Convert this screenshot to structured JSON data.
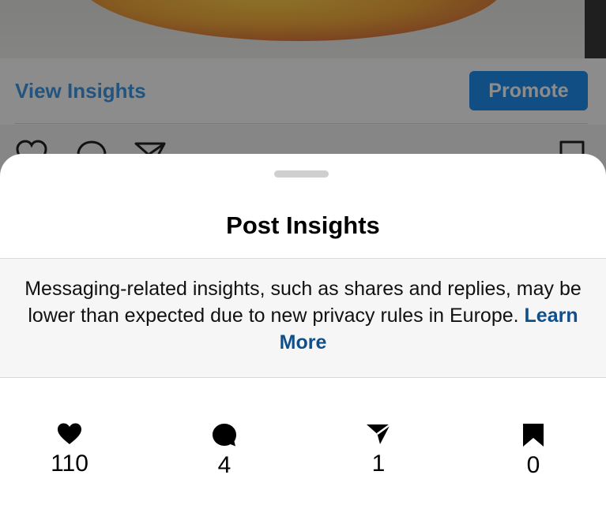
{
  "background_post": {
    "view_insights_label": "View Insights",
    "promote_label": "Promote",
    "colors": {
      "link": "#3f9ae8",
      "promote_bg": "#1f8ef1"
    },
    "icons": [
      "heart-outline-icon",
      "comment-outline-icon",
      "share-outline-icon",
      "bookmark-outline-icon"
    ]
  },
  "sheet": {
    "title": "Post Insights",
    "notice": {
      "text": "Messaging-related insights, such as shares and replies, may be lower than expected due to new privacy rules in Europe.",
      "link_label": "Learn More",
      "link_color": "#0f4f8c"
    },
    "stats": [
      {
        "icon": "heart-icon",
        "value": "110"
      },
      {
        "icon": "comment-icon",
        "value": "4"
      },
      {
        "icon": "share-icon",
        "value": "1"
      },
      {
        "icon": "bookmark-icon",
        "value": "0"
      }
    ]
  }
}
